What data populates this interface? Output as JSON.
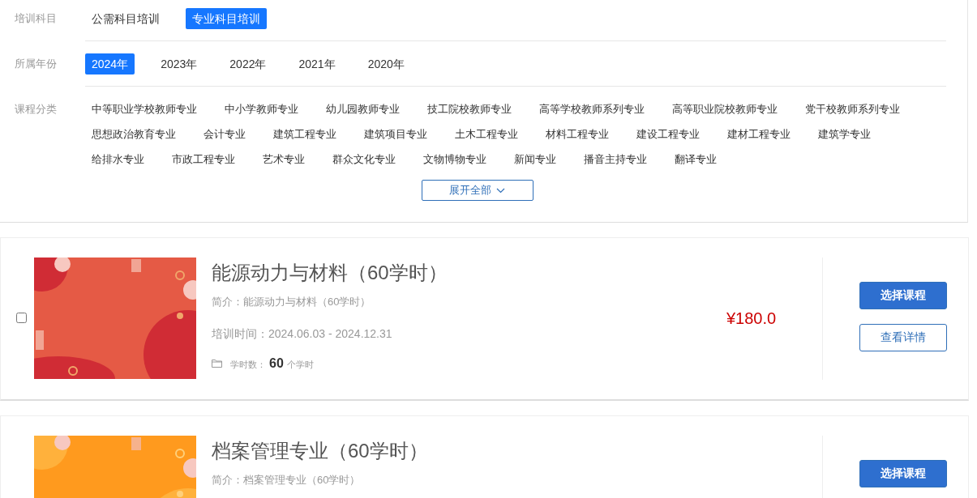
{
  "filters": [
    {
      "label": "培训科目",
      "kind": "chips",
      "options": [
        {
          "label": "公需科目培训",
          "selected": false
        },
        {
          "label": "专业科目培训",
          "selected": true
        }
      ]
    },
    {
      "label": "所属年份",
      "kind": "chips",
      "options": [
        {
          "label": "2024年",
          "selected": true
        },
        {
          "label": "2023年",
          "selected": false
        },
        {
          "label": "2022年",
          "selected": false
        },
        {
          "label": "2021年",
          "selected": false
        },
        {
          "label": "2020年",
          "selected": false
        }
      ]
    },
    {
      "label": "课程分类",
      "kind": "links",
      "options": [
        {
          "label": "中等职业学校教师专业",
          "selected": false
        },
        {
          "label": "中小学教师专业",
          "selected": false
        },
        {
          "label": "幼儿园教师专业",
          "selected": false
        },
        {
          "label": "技工院校教师专业",
          "selected": false
        },
        {
          "label": "高等学校教师系列专业",
          "selected": false
        },
        {
          "label": "高等职业院校教师专业",
          "selected": false
        },
        {
          "label": "党干校教师系列专业",
          "selected": false
        },
        {
          "label": "思想政治教育专业",
          "selected": false
        },
        {
          "label": "会计专业",
          "selected": false
        },
        {
          "label": "建筑工程专业",
          "selected": false
        },
        {
          "label": "建筑项目专业",
          "selected": false
        },
        {
          "label": "土木工程专业",
          "selected": false
        },
        {
          "label": "材料工程专业",
          "selected": false
        },
        {
          "label": "建设工程专业",
          "selected": false
        },
        {
          "label": "建材工程专业",
          "selected": false
        },
        {
          "label": "建筑学专业",
          "selected": false
        },
        {
          "label": "给排水专业",
          "selected": false
        },
        {
          "label": "市政工程专业",
          "selected": false
        },
        {
          "label": "艺术专业",
          "selected": false
        },
        {
          "label": "群众文化专业",
          "selected": false
        },
        {
          "label": "文物博物专业",
          "selected": false
        },
        {
          "label": "新闻专业",
          "selected": false
        },
        {
          "label": "播音主持专业",
          "selected": false
        },
        {
          "label": "翻译专业",
          "selected": false
        }
      ]
    }
  ],
  "expand_button": "展开全部",
  "courses": [
    {
      "checked": false,
      "title": "能源动力与材料（60学时）",
      "intro": "简介：能源动力与材料（60学时）",
      "time": "培训时间：2024.06.03 - 2024.12.31",
      "hours_label": "学时数：",
      "hours": "60",
      "hours_unit": "个学时",
      "price": "¥180.0",
      "buttons": [
        "选择课程",
        "查看详情"
      ]
    },
    {
      "title": "档案管理专业（60学时）",
      "intro": "简介：档案管理专业（60学时）",
      "buttons": [
        "选择课程"
      ]
    }
  ]
}
